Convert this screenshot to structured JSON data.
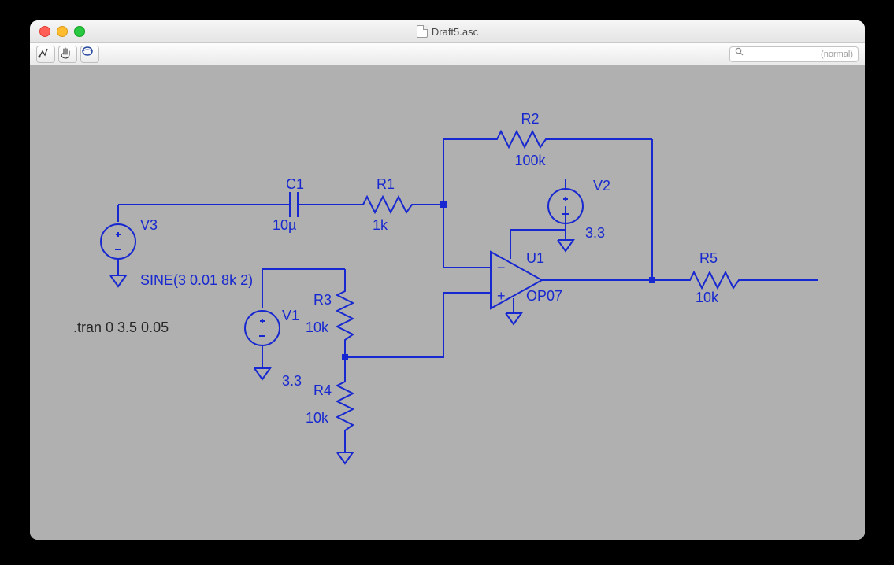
{
  "window": {
    "title": "Draft5.asc"
  },
  "search": {
    "placeholder": "(normal)"
  },
  "directive": ".tran 0 3.5 0.05",
  "components": {
    "V3": {
      "name": "V3",
      "value": "SINE(3 0.01 8k 2)"
    },
    "C1": {
      "name": "C1",
      "value": "10µ"
    },
    "R1": {
      "name": "R1",
      "value": "1k"
    },
    "R2": {
      "name": "R2",
      "value": "100k"
    },
    "V2": {
      "name": "V2",
      "value": "3.3"
    },
    "U1": {
      "name": "U1",
      "value": "OP07"
    },
    "R5": {
      "name": "R5",
      "value": "10k"
    },
    "V1": {
      "name": "V1",
      "value": "3.3"
    },
    "R3": {
      "name": "R3",
      "value": "10k"
    },
    "R4": {
      "name": "R4",
      "value": "10k"
    }
  }
}
